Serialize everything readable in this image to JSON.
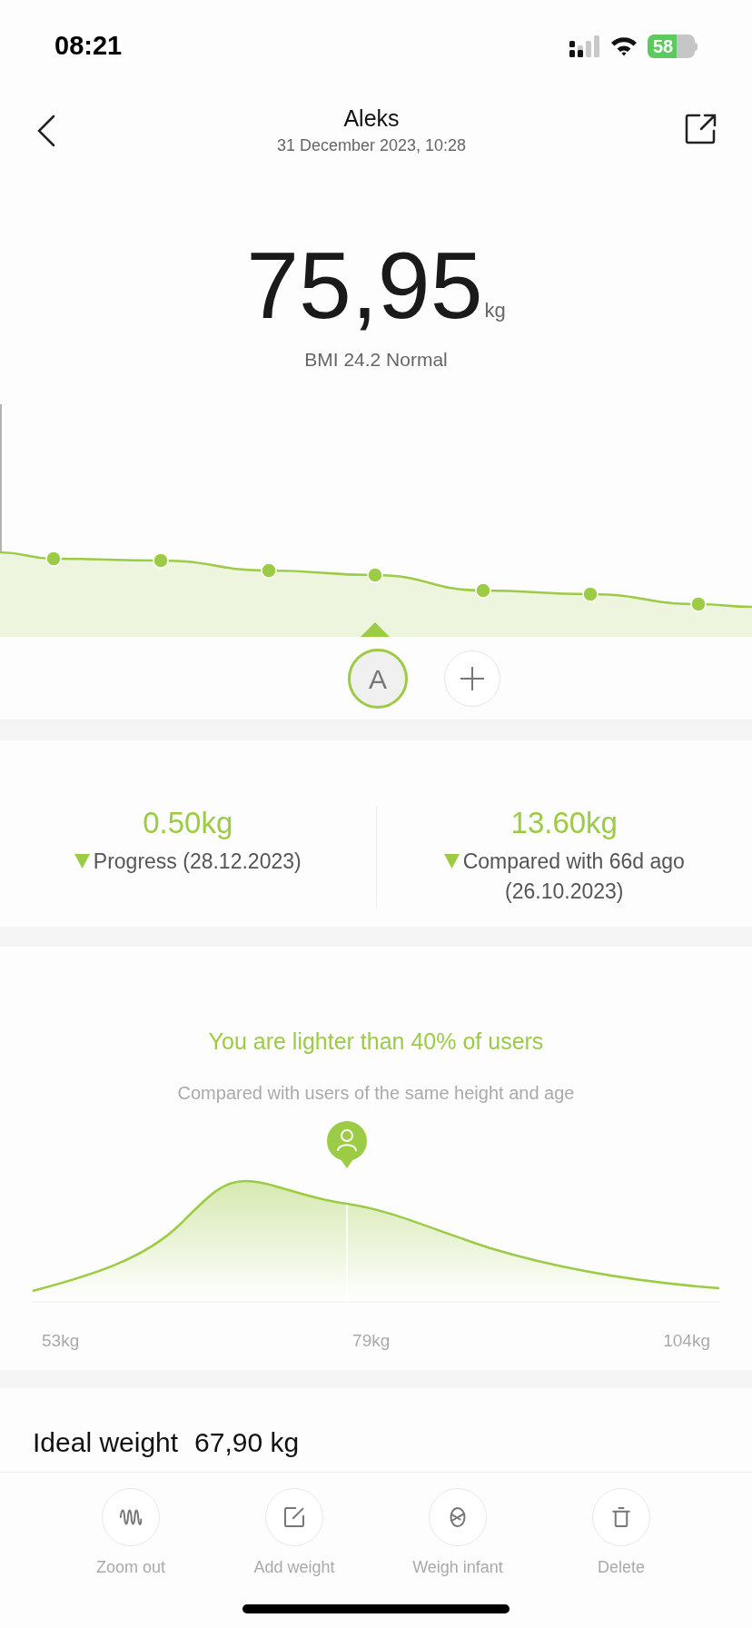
{
  "status_bar": {
    "time": "08:21",
    "battery": "58"
  },
  "header": {
    "title": "Aleks",
    "subtitle": "31 December 2023, 10:28"
  },
  "weight": {
    "value": "75,95",
    "unit": "kg",
    "bmi": "BMI 24.2 Normal"
  },
  "users": [
    {
      "initial": "A",
      "selected": true
    }
  ],
  "stats": [
    {
      "value": "0.50kg",
      "decreased": true,
      "label": "Progress (28.12.2023)"
    },
    {
      "value": "13.60kg",
      "decreased": true,
      "label": "Compared with 66d ago (26.10.2023)"
    }
  ],
  "ranking": {
    "title": "You are lighter than 40% of users",
    "subtitle": "Compared with users of the same height and age",
    "axis_labels": [
      "53kg",
      "79kg",
      "104kg"
    ]
  },
  "ideal": {
    "label": "Ideal weight",
    "value": "67,90 kg"
  },
  "actions": [
    {
      "kind": "wave",
      "label": "Zoom out"
    },
    {
      "kind": "edit",
      "label": "Add weight"
    },
    {
      "kind": "infant",
      "label": "Weigh infant"
    },
    {
      "kind": "trash",
      "label": "Delete"
    }
  ]
}
